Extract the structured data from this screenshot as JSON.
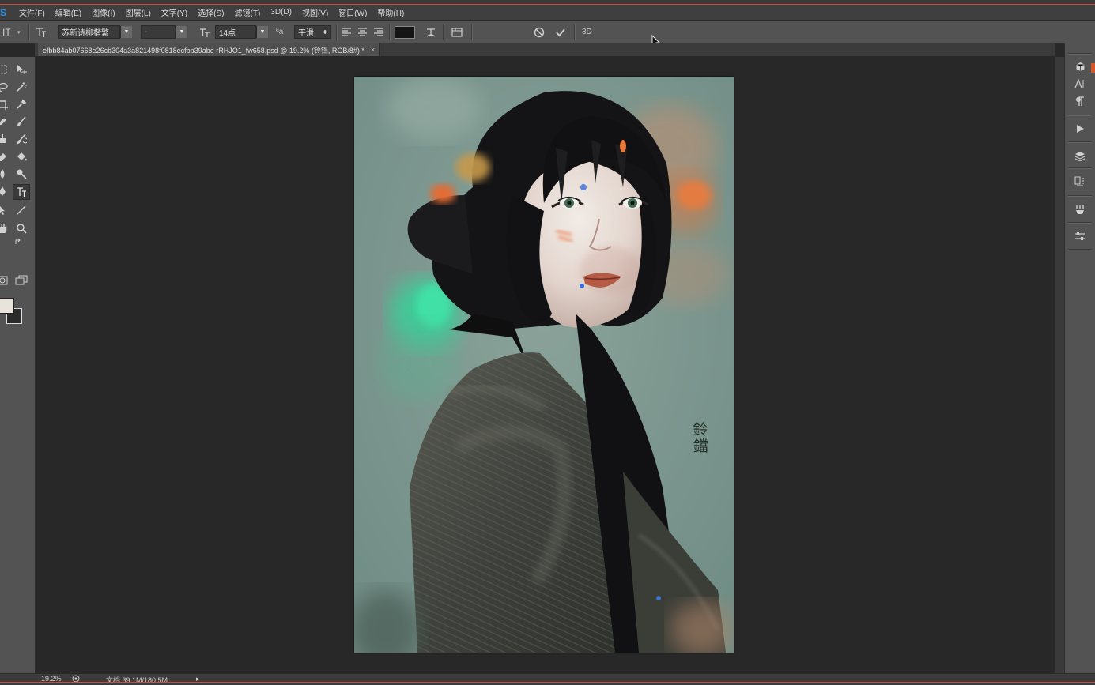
{
  "app": {
    "logo": "S",
    "accent": "#2f8fe0"
  },
  "menu": [
    "文件(F)",
    "编辑(E)",
    "图像(I)",
    "图层(L)",
    "文字(Y)",
    "选择(S)",
    "滤镜(T)",
    "3D(D)",
    "视图(V)",
    "窗口(W)",
    "帮助(H)"
  ],
  "options": {
    "tool_label": "IT",
    "font_family": "苏新诗柳楷繁",
    "font_style": "-",
    "font_size": "14点",
    "aa_label": "ªa",
    "antialias": "平滑",
    "color_swatch": "#141414",
    "three_d": "3D",
    "cancel_icon": "cancel-icon",
    "commit_icon": "commit-icon"
  },
  "document": {
    "tab_title": "efbb84ab07668e26cb304a3a821498f0818ecfbb39abc-rRHJO1_fw658.psd @ 19.2% (铃铛, RGB/8#) *",
    "close": "×",
    "signature": "鈴鐺"
  },
  "status": {
    "zoom": "19.2%",
    "doc_info": "文档:39.1M/180.5M",
    "arrow": "▸"
  },
  "colors": {
    "foreground": "#e8e4dc",
    "background": "#2b2b2b",
    "accent_line": "#c0503a"
  }
}
